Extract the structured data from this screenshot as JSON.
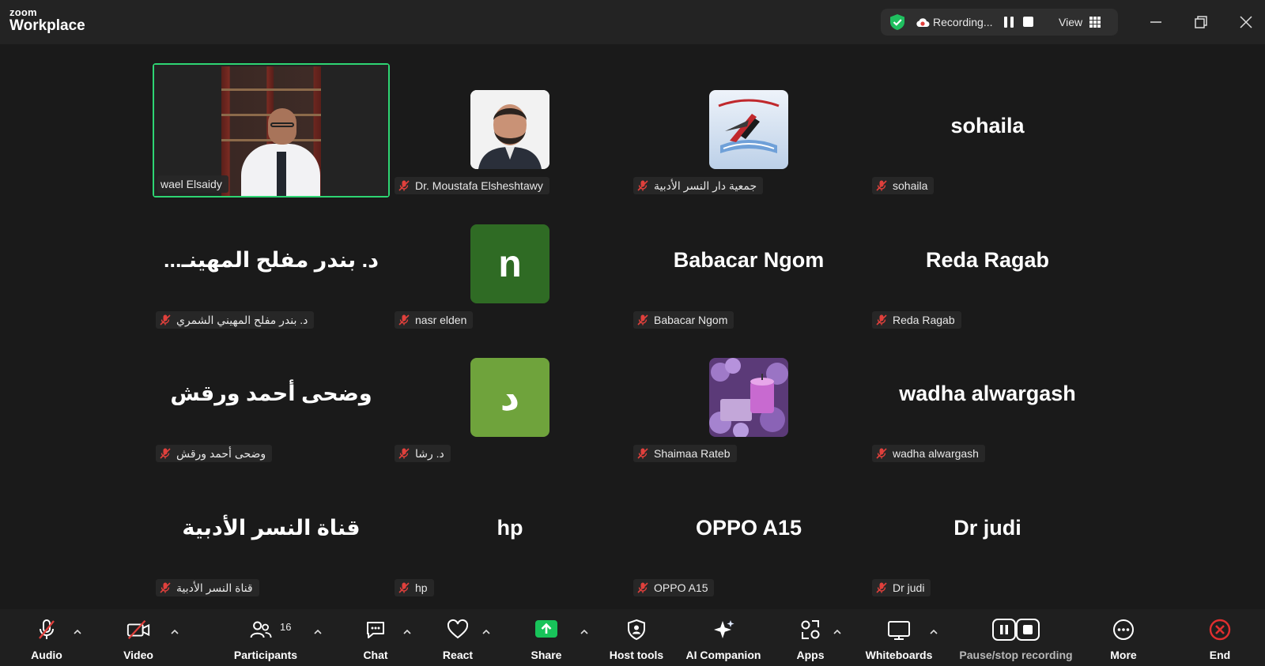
{
  "app": {
    "brand_line1": "zoom",
    "brand_line2": "Workplace"
  },
  "recording": {
    "status_text": "Recording...",
    "view_label": "View"
  },
  "tiles": [
    {
      "tag": "wael Elsaidy",
      "type": "video"
    },
    {
      "tag": "Dr. Moustafa Elsheshtawy",
      "type": "photo"
    },
    {
      "tag": "جمعية دار النسر الأدبية",
      "type": "logo"
    },
    {
      "tag": "sohaila",
      "type": "name",
      "display": "sohaila"
    },
    {
      "tag": "د. بندر مفلح المهيني الشمري",
      "type": "name",
      "display": "...د. بندر مفلح المهينـ"
    },
    {
      "tag": "nasr elden",
      "type": "letter",
      "letter": "n",
      "color": "#2f6b24"
    },
    {
      "tag": "Babacar Ngom",
      "type": "name",
      "display": "Babacar Ngom"
    },
    {
      "tag": "Reda Ragab",
      "type": "name",
      "display": "Reda Ragab"
    },
    {
      "tag": "وضحى أحمد ورقش",
      "type": "name",
      "display": "وضحى أحمد ورقش"
    },
    {
      "tag": "د. رشا",
      "type": "letter",
      "letter": "د",
      "color": "#6fa33c"
    },
    {
      "tag": "Shaimaa Rateb",
      "type": "flowers"
    },
    {
      "tag": "wadha alwargash",
      "type": "name",
      "display": "wadha alwargash"
    },
    {
      "tag": "قناة النسر الأدبية",
      "type": "name",
      "display": "قناة النسر الأدبية"
    },
    {
      "tag": "hp",
      "type": "name",
      "display": "hp"
    },
    {
      "tag": "OPPO A15",
      "type": "name",
      "display": "OPPO A15"
    },
    {
      "tag": "Dr judi",
      "type": "name",
      "display": "Dr judi"
    }
  ],
  "toolbar": {
    "audio": "Audio",
    "video": "Video",
    "participants": "Participants",
    "participants_count": "16",
    "chat": "Chat",
    "react": "React",
    "share": "Share",
    "host_tools": "Host tools",
    "ai_companion": "AI Companion",
    "apps": "Apps",
    "whiteboards": "Whiteboards",
    "pause_stop_recording": "Pause/stop recording",
    "more": "More",
    "end": "End"
  },
  "colors": {
    "active_speaker": "#2ed573",
    "share_green": "#18c35a",
    "end_red": "#e02f2f",
    "mute_red": "#e0403c"
  }
}
